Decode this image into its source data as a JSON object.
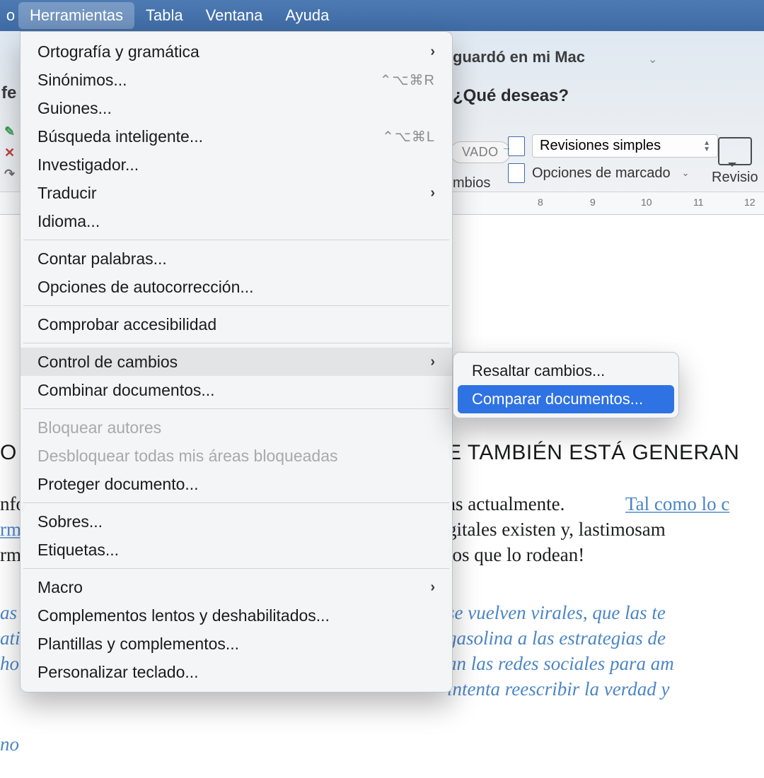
{
  "menubar": {
    "stub": "o",
    "items": [
      "Herramientas",
      "Tabla",
      "Ventana",
      "Ayuda"
    ],
    "active_index": 0
  },
  "window": {
    "title_suffix": "guardó en mi Mac",
    "tell_me": "¿Qué deseas?",
    "pill": "VADO",
    "changes_label": "mbios",
    "review_dropdown": "Revisiones simples",
    "markup_label": "Opciones de marcado",
    "revision_button": "Revisio"
  },
  "ruler": {
    "numbers": [
      "8",
      "9",
      "10",
      "11",
      "12"
    ]
  },
  "left_strip": {
    "text": "fe"
  },
  "menu": {
    "items": [
      {
        "label": "Ortografía y gramática",
        "type": "submenu"
      },
      {
        "label": "Sinónimos...",
        "shortcut": "⌃⌥⌘R"
      },
      {
        "label": "Guiones..."
      },
      {
        "label": "Búsqueda inteligente...",
        "shortcut": "⌃⌥⌘L"
      },
      {
        "label": "Investigador..."
      },
      {
        "label": "Traducir",
        "type": "submenu"
      },
      {
        "label": "Idioma..."
      },
      {
        "type": "sep"
      },
      {
        "label": "Contar palabras..."
      },
      {
        "label": "Opciones de autocorrección..."
      },
      {
        "type": "sep"
      },
      {
        "label": "Comprobar accesibilidad"
      },
      {
        "type": "sep"
      },
      {
        "label": "Control de cambios",
        "type": "submenu",
        "hovered": true
      },
      {
        "label": "Combinar documentos..."
      },
      {
        "type": "sep"
      },
      {
        "label": "Bloquear autores",
        "disabled": true
      },
      {
        "label": "Desbloquear todas mis áreas bloqueadas",
        "disabled": true
      },
      {
        "label": "Proteger documento..."
      },
      {
        "type": "sep"
      },
      {
        "label": "Sobres..."
      },
      {
        "label": "Etiquetas..."
      },
      {
        "type": "sep"
      },
      {
        "label": "Macro",
        "type": "submenu"
      },
      {
        "label": "Complementos lentos y deshabilitados..."
      },
      {
        "label": "Plantillas y complementos..."
      },
      {
        "label": "Personalizar teclado..."
      }
    ]
  },
  "submenu": {
    "items": [
      {
        "label": "Resaltar cambios..."
      },
      {
        "label": "Comparar documentos...",
        "selected": true
      }
    ]
  },
  "doc": {
    "left_heading": "O",
    "left_lines": [
      "nfo",
      "rm",
      "rm",
      "",
      "as",
      "ati",
      "ho",
      "",
      "no"
    ],
    "heading_right": "E TAMBIÉN ESTÁ GENERAN",
    "black_lines": [
      "as actualmente. ",
      "gitales existen y, lastimosam",
      "los que lo rodean!"
    ],
    "link_text": "Tal como lo c",
    "blue_ital_lines": [
      "se vuelven virales, que las te",
      "gasolina a las estrategias de ",
      "an las redes sociales para am",
      "intenta reescribir la verdad y"
    ]
  }
}
